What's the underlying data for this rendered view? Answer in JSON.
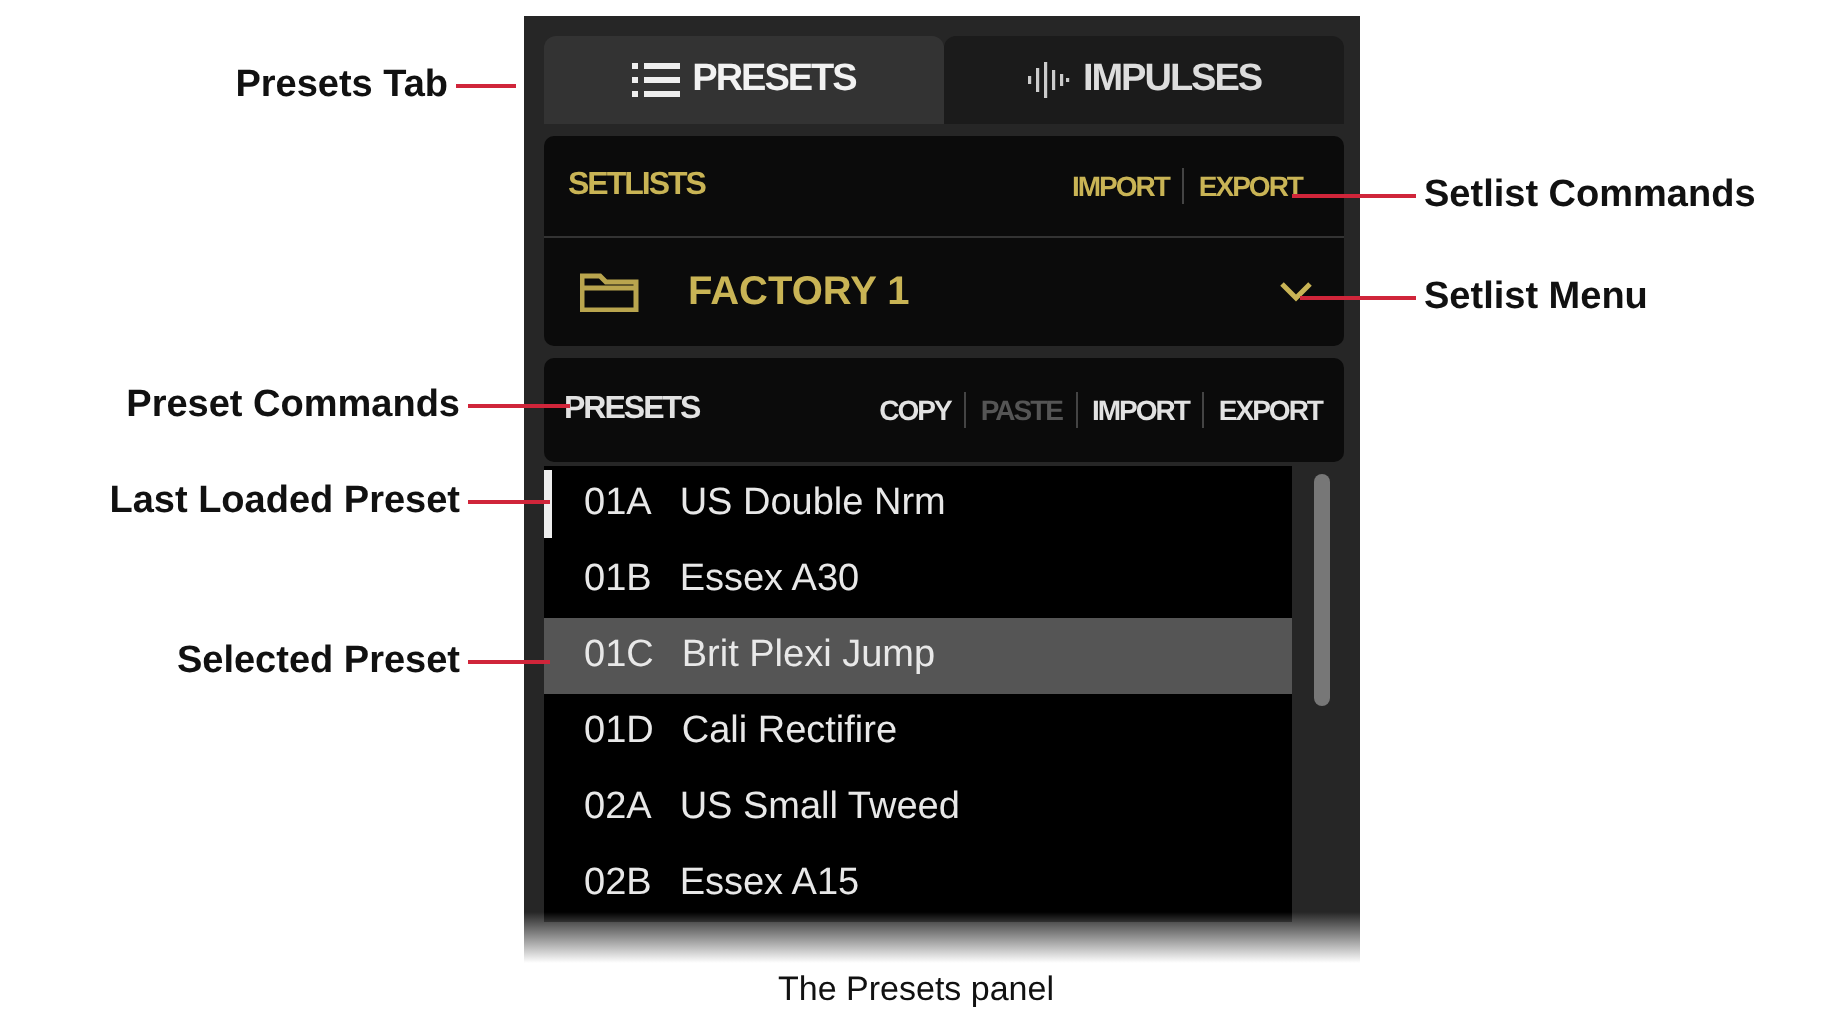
{
  "tabs": [
    {
      "label": "PRESETS",
      "selected": true
    },
    {
      "label": "IMPULSES",
      "selected": false
    }
  ],
  "setlists": {
    "title": "SETLISTS",
    "commands": [
      {
        "label": "IMPORT",
        "disabled": false
      },
      {
        "label": "EXPORT",
        "disabled": false
      }
    ],
    "current": "FACTORY 1"
  },
  "presets": {
    "title": "PRESETS",
    "commands": [
      {
        "label": "COPY",
        "disabled": false
      },
      {
        "label": "PASTE",
        "disabled": true
      },
      {
        "label": "IMPORT",
        "disabled": false
      },
      {
        "label": "EXPORT",
        "disabled": false
      }
    ],
    "items": [
      {
        "slot": "01A",
        "name": "US Double Nrm",
        "selected": false,
        "last_loaded": true
      },
      {
        "slot": "01B",
        "name": "Essex A30",
        "selected": false,
        "last_loaded": false
      },
      {
        "slot": "01C",
        "name": "Brit Plexi Jump",
        "selected": true,
        "last_loaded": false
      },
      {
        "slot": "01D",
        "name": "Cali Rectifire",
        "selected": false,
        "last_loaded": false
      },
      {
        "slot": "02A",
        "name": "US Small Tweed",
        "selected": false,
        "last_loaded": false
      },
      {
        "slot": "02B",
        "name": "Essex A15",
        "selected": false,
        "last_loaded": false
      }
    ]
  },
  "callouts": [
    {
      "label": "Presets Tab"
    },
    {
      "label": "Setlist Commands"
    },
    {
      "label": "Setlist Menu"
    },
    {
      "label": "Preset Commands"
    },
    {
      "label": "Last Loaded Preset"
    },
    {
      "label": "Selected Preset"
    }
  ],
  "caption": "The Presets panel"
}
